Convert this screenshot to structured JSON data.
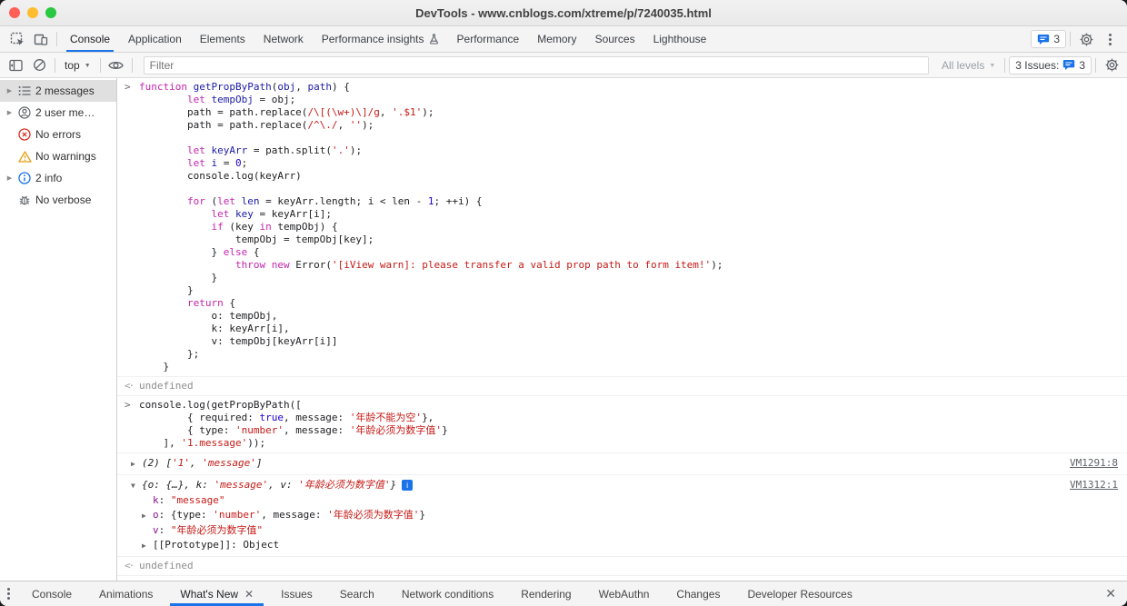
{
  "window": {
    "title": "DevTools - www.cnblogs.com/xtreme/p/7240035.html"
  },
  "colors": {
    "accent_blue": "#1a73e8",
    "error_red": "#d93025",
    "warning_orange": "#e8a015",
    "keyword": "#c526ac",
    "string": "#c41a16",
    "number": "#1c00cf",
    "property": "#881391",
    "definition": "#1a1aa6"
  },
  "tabbar": {
    "tabs": [
      {
        "label": "Console",
        "active": true
      },
      {
        "label": "Application"
      },
      {
        "label": "Elements"
      },
      {
        "label": "Network"
      },
      {
        "label": "Performance insights",
        "icon": "flask-icon"
      },
      {
        "label": "Performance"
      },
      {
        "label": "Memory"
      },
      {
        "label": "Sources"
      },
      {
        "label": "Lighthouse"
      }
    ],
    "issues_badge_count": "3"
  },
  "toolbar": {
    "context_label": "top",
    "filter_placeholder": "Filter",
    "levels_label": "All levels",
    "issues_text": "3 Issues:",
    "issues_count": "3"
  },
  "sidebar": {
    "items": [
      {
        "label": "2 messages",
        "icon": "messages-list-icon",
        "expandable": true,
        "selected": true
      },
      {
        "label": "2 user me…",
        "icon": "user-icon",
        "expandable": true
      },
      {
        "label": "No errors",
        "icon": "error-icon"
      },
      {
        "label": "No warnings",
        "icon": "warning-icon"
      },
      {
        "label": "2 info",
        "icon": "info-icon",
        "expandable": true
      },
      {
        "label": "No verbose",
        "icon": "verbose-icon"
      }
    ]
  },
  "console": {
    "entries": [
      {
        "type": "input",
        "lines": [
          {
            "seg": [
              [
                "k",
                "function"
              ],
              [
                "p",
                " "
              ],
              [
                "d",
                "getPropByPath"
              ],
              [
                "p",
                "("
              ],
              [
                "d",
                "obj"
              ],
              [
                "p",
                ", "
              ],
              [
                "d",
                "path"
              ],
              [
                "p",
                ") {"
              ]
            ]
          },
          {
            "seg": [
              [
                "p",
                "        "
              ],
              [
                "k",
                "let"
              ],
              [
                "p",
                " "
              ],
              [
                "d",
                "tempObj"
              ],
              [
                "p",
                " = obj;"
              ]
            ]
          },
          {
            "seg": [
              [
                "p",
                "        path = path.replace("
              ],
              [
                "s",
                "/\\[(\\w+)\\]/g"
              ],
              [
                "p",
                ", "
              ],
              [
                "s",
                "'.$1'"
              ],
              [
                "p",
                ");"
              ]
            ]
          },
          {
            "seg": [
              [
                "p",
                "        path = path.replace("
              ],
              [
                "s",
                "/^\\./"
              ],
              [
                "p",
                ", "
              ],
              [
                "s",
                "''"
              ],
              [
                "p",
                ");"
              ]
            ]
          },
          {
            "seg": []
          },
          {
            "seg": [
              [
                "p",
                "        "
              ],
              [
                "k",
                "let"
              ],
              [
                "p",
                " "
              ],
              [
                "d",
                "keyArr"
              ],
              [
                "p",
                " = path.split("
              ],
              [
                "s",
                "'.'"
              ],
              [
                "p",
                ");"
              ]
            ]
          },
          {
            "seg": [
              [
                "p",
                "        "
              ],
              [
                "k",
                "let"
              ],
              [
                "p",
                " "
              ],
              [
                "d",
                "i"
              ],
              [
                "p",
                " = "
              ],
              [
                "n",
                "0"
              ],
              [
                "p",
                ";"
              ]
            ]
          },
          {
            "seg": [
              [
                "p",
                "        console.log(keyArr)"
              ]
            ]
          },
          {
            "seg": []
          },
          {
            "seg": [
              [
                "p",
                "        "
              ],
              [
                "k",
                "for"
              ],
              [
                "p",
                " ("
              ],
              [
                "k",
                "let"
              ],
              [
                "p",
                " "
              ],
              [
                "d",
                "len"
              ],
              [
                "p",
                " = keyArr.length; i < len - "
              ],
              [
                "n",
                "1"
              ],
              [
                "p",
                "; ++i) {"
              ]
            ]
          },
          {
            "seg": [
              [
                "p",
                "            "
              ],
              [
                "k",
                "let"
              ],
              [
                "p",
                " "
              ],
              [
                "d",
                "key"
              ],
              [
                "p",
                " = keyArr[i];"
              ]
            ]
          },
          {
            "seg": [
              [
                "p",
                "            "
              ],
              [
                "k",
                "if"
              ],
              [
                "p",
                " (key "
              ],
              [
                "k",
                "in"
              ],
              [
                "p",
                " tempObj) {"
              ]
            ]
          },
          {
            "seg": [
              [
                "p",
                "                tempObj = tempObj[key];"
              ]
            ]
          },
          {
            "seg": [
              [
                "p",
                "            } "
              ],
              [
                "k",
                "else"
              ],
              [
                "p",
                " {"
              ]
            ]
          },
          {
            "seg": [
              [
                "p",
                "                "
              ],
              [
                "k",
                "throw"
              ],
              [
                "p",
                " "
              ],
              [
                "k",
                "new"
              ],
              [
                "p",
                " Error("
              ],
              [
                "s",
                "'[iView warn]: please transfer a valid prop path to form item!'"
              ],
              [
                "p",
                ");"
              ]
            ]
          },
          {
            "seg": [
              [
                "p",
                "            }"
              ]
            ]
          },
          {
            "seg": [
              [
                "p",
                "        }"
              ]
            ]
          },
          {
            "seg": [
              [
                "p",
                "        "
              ],
              [
                "k",
                "return"
              ],
              [
                "p",
                " {"
              ]
            ]
          },
          {
            "seg": [
              [
                "p",
                "            o: tempObj,"
              ]
            ]
          },
          {
            "seg": [
              [
                "p",
                "            k: keyArr[i],"
              ]
            ]
          },
          {
            "seg": [
              [
                "p",
                "            v: tempObj[keyArr[i]]"
              ]
            ]
          },
          {
            "seg": [
              [
                "p",
                "        };"
              ]
            ]
          },
          {
            "seg": [
              [
                "p",
                "    }"
              ]
            ]
          }
        ]
      },
      {
        "type": "result",
        "lines": [
          {
            "seg": [
              [
                "g",
                "undefined"
              ]
            ]
          }
        ]
      },
      {
        "type": "input",
        "lines": [
          {
            "seg": [
              [
                "p",
                "console.log(getPropByPath(["
              ]
            ]
          },
          {
            "seg": [
              [
                "p",
                "        { required: "
              ],
              [
                "n",
                "true"
              ],
              [
                "p",
                ", message: "
              ],
              [
                "s",
                "'年龄不能为空'"
              ],
              [
                "p",
                "},"
              ]
            ]
          },
          {
            "seg": [
              [
                "p",
                "        { type: "
              ],
              [
                "s",
                "'number'"
              ],
              [
                "p",
                ", message: "
              ],
              [
                "s",
                "'年龄必须为数字值'"
              ],
              [
                "p",
                "}"
              ]
            ]
          },
          {
            "seg": [
              [
                "p",
                "    ], "
              ],
              [
                "s",
                "'1.message'"
              ],
              [
                "p",
                "));"
              ]
            ]
          }
        ]
      },
      {
        "type": "log",
        "link": "VM1291:8",
        "lines": [
          {
            "tri": "r",
            "it": true,
            "seg": [
              [
                "p",
                "(2) ["
              ],
              [
                "s",
                "'1'"
              ],
              [
                "p",
                ", "
              ],
              [
                "s",
                "'message'"
              ],
              [
                "p",
                "]"
              ]
            ]
          }
        ]
      },
      {
        "type": "log",
        "link": "VM1312:1",
        "lines": [
          {
            "tri": "d",
            "it": true,
            "info": true,
            "seg": [
              [
                "p",
                "{o: {…}, k: "
              ],
              [
                "s",
                "'message'"
              ],
              [
                "p",
                ", v: "
              ],
              [
                "s",
                "'年龄必须为数字值'"
              ],
              [
                "p",
                "}"
              ]
            ]
          },
          {
            "ind": 1,
            "seg": [
              [
                "pr",
                "k"
              ],
              [
                "p",
                ": "
              ],
              [
                "s",
                "\"message\""
              ]
            ]
          },
          {
            "ind": 1,
            "tri": "r",
            "seg": [
              [
                "pr",
                "o"
              ],
              [
                "p",
                ": {type: "
              ],
              [
                "s",
                "'number'"
              ],
              [
                "p",
                ", message: "
              ],
              [
                "s",
                "'年龄必须为数字值'"
              ],
              [
                "p",
                "}"
              ]
            ]
          },
          {
            "ind": 1,
            "seg": [
              [
                "pr",
                "v"
              ],
              [
                "p",
                ": "
              ],
              [
                "s",
                "\"年龄必须为数字值\""
              ]
            ]
          },
          {
            "ind": 1,
            "tri": "r",
            "seg": [
              [
                "p",
                "[[Prototype]]: Object"
              ]
            ]
          }
        ]
      },
      {
        "type": "result",
        "lines": [
          {
            "seg": [
              [
                "g",
                "undefined"
              ]
            ]
          }
        ]
      },
      {
        "type": "prompt",
        "lines": []
      }
    ]
  },
  "drawer": {
    "tabs": [
      {
        "label": "Console"
      },
      {
        "label": "Animations"
      },
      {
        "label": "What's New",
        "active": true,
        "closable": true
      },
      {
        "label": "Issues"
      },
      {
        "label": "Search"
      },
      {
        "label": "Network conditions"
      },
      {
        "label": "Rendering"
      },
      {
        "label": "WebAuthn"
      },
      {
        "label": "Changes"
      },
      {
        "label": "Developer Resources"
      }
    ]
  }
}
